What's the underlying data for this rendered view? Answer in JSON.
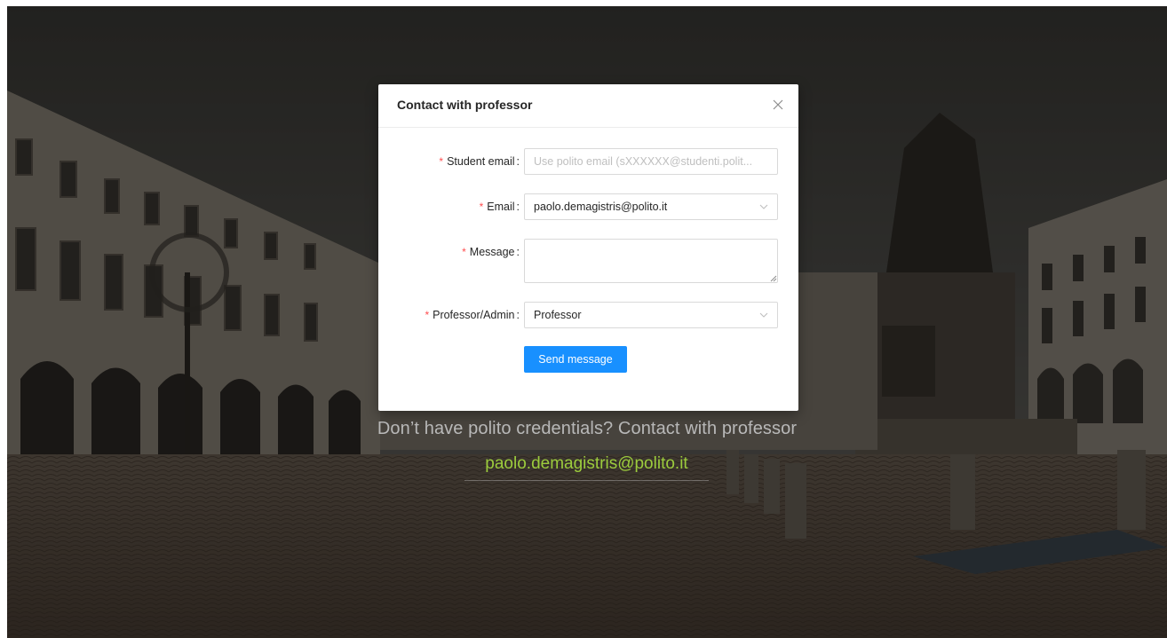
{
  "modal": {
    "title": "Contact with professor",
    "fields": {
      "student_email": {
        "label": "Student email",
        "value": "",
        "placeholder": "Use polito email (sXXXXXX@studenti.polit..."
      },
      "email": {
        "label": "Email",
        "value": "paolo.demagistris@polito.it"
      },
      "message": {
        "label": "Message",
        "value": ""
      },
      "role": {
        "label": "Professor/Admin",
        "value": "Professor"
      }
    },
    "required_mark": "*",
    "submit_label": "Send message"
  },
  "background": {
    "footer_text": "Don’t have polito credentials? Contact with professor",
    "footer_email": "paolo.demagistris@polito.it"
  },
  "colors": {
    "primary": "#1890ff",
    "required": "#ff4d4f",
    "link_green": "#9ccc3d"
  },
  "icons": {
    "close": "close-icon",
    "select_arrow": "chevron-down-icon"
  }
}
